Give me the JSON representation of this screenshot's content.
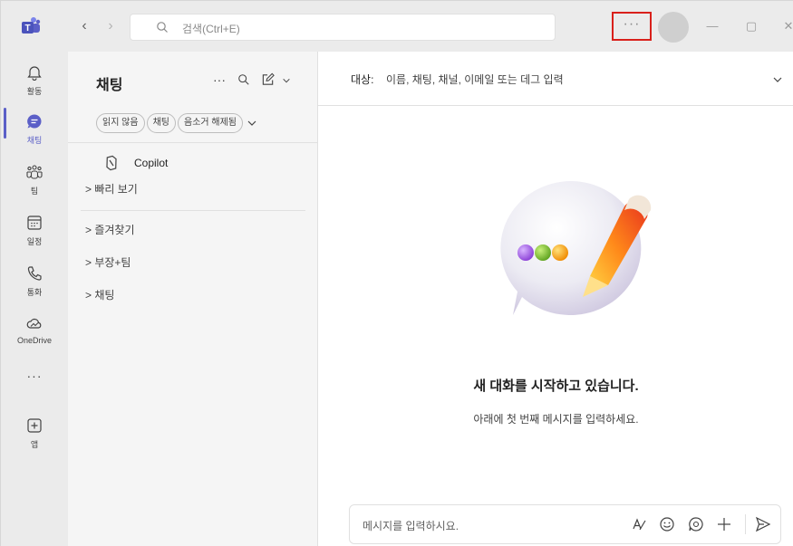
{
  "titlebar": {
    "search_placeholder": "검색(Ctrl+E)",
    "more_label": "···",
    "back_glyph": "‹",
    "forward_glyph": "›",
    "minimize_glyph": "—",
    "maximize_glyph": "▢",
    "close_glyph": "✕"
  },
  "rail": {
    "items": [
      {
        "label": "활동",
        "icon": "bell-icon"
      },
      {
        "label": "채팅",
        "icon": "chat-icon",
        "active": true
      },
      {
        "label": "팀",
        "icon": "teams-icon"
      },
      {
        "label": "일정",
        "icon": "calendar-icon"
      },
      {
        "label": "통화",
        "icon": "phone-icon"
      },
      {
        "label": "OneDrive",
        "icon": "cloud-icon"
      },
      {
        "label": "앱",
        "icon": "add-app-icon"
      }
    ],
    "more_label": "···",
    "accent": "#5b5fc7"
  },
  "chatpane": {
    "title": "채팅",
    "more_label": "···",
    "filters": [
      "읽지 않음",
      "채팅",
      "음소거 해제됨"
    ],
    "copilot_label": "Copilot",
    "sections": [
      "> 빠리 보기",
      "> 즐겨찾기",
      "> 부장+팀",
      "> 채팅"
    ]
  },
  "main": {
    "to_label": "대상:",
    "to_hint": "이름, 채팅, 채널, 이메일 또는 데그 입력",
    "empty_title": "새 대화를 시작하고 있습니다.",
    "empty_subtitle": "아래에 첫 번째 메시지를 입력하세요.",
    "composer_placeholder": "메시지를 입력하시요."
  },
  "colors": {
    "highlight_box": "#d9201b",
    "titlebar_bg": "#ebebeb",
    "pane_bg": "#f5f5f5"
  }
}
